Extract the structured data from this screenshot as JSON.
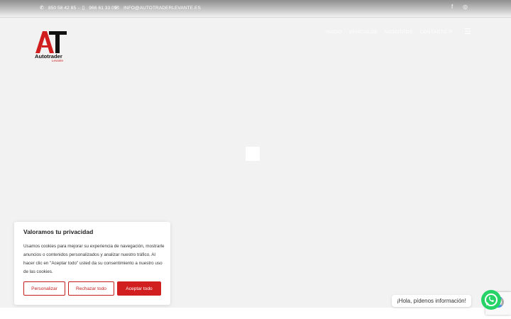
{
  "topbar": {
    "phone_icon": "phone-icon",
    "phone_1": "850 58 42 85",
    "separator": "-",
    "mobile_icon": "mobile-icon",
    "phone_2": "966 61 33 05",
    "email_icon": "email-icon",
    "email": "INFO@AUTOTRADERLEVANTE.ES",
    "social": [
      {
        "name": "facebook-icon",
        "glyph": "f"
      },
      {
        "name": "instagram-icon",
        "glyph": "◎"
      }
    ]
  },
  "logo": {
    "letters": "AT",
    "brand": "Autotrader",
    "sub": "Levante",
    "colors": {
      "red": "#d11f1f",
      "black": "#111111"
    }
  },
  "nav": {
    "items": [
      "INICIO",
      "VEHÍCULOS",
      "NOSOTROS",
      "CONTACTO"
    ],
    "search_icon": "search-icon",
    "menu_icon": "hamburger-menu-icon"
  },
  "cookie": {
    "title": "Valoramos tu privacidad",
    "text": "Usamos cookies para mejorar su experiencia de navegación, mostrarle anuncios o contenidos personalizados y analizar nuestro tráfico. Al hacer clic en \"Aceptar todo\" usted da su consentimiento a nuestro uso de las cookies.",
    "customize": "Personalizar",
    "reject": "Rechazar todo",
    "accept": "Aceptar todo",
    "accent": "#d11f1f"
  },
  "whatsapp": {
    "label": "¡Hola, pídenos información!",
    "icon": "whatsapp-icon",
    "color": "#25d366"
  }
}
